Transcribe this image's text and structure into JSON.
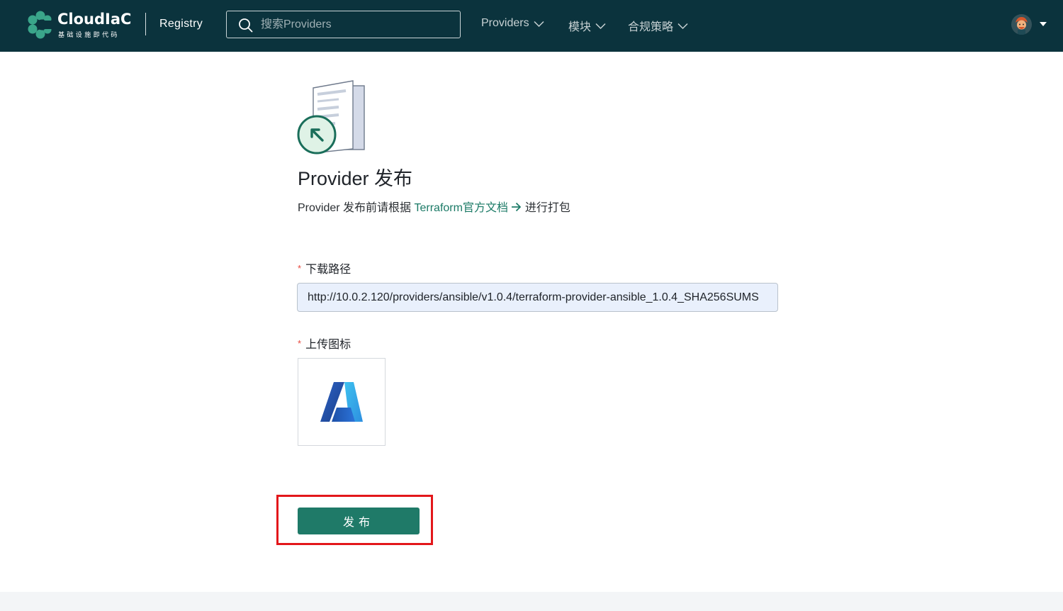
{
  "header": {
    "logo_title": "CloudIaC",
    "logo_subtitle": "基础设施即代码",
    "registry_label": "Registry",
    "search_placeholder": "搜索Providers",
    "nav": [
      {
        "label": "Providers"
      },
      {
        "label": "模块"
      },
      {
        "label": "合规策略"
      }
    ]
  },
  "main": {
    "title": "Provider 发布",
    "subtitle_prefix": "Provider 发布前请根据",
    "subtitle_link": "Terraform官方文档",
    "subtitle_suffix": "进行打包",
    "download_path_label": "下载路径",
    "download_path_value": "http://10.0.2.120/providers/ansible/v1.0.4/terraform-provider-ansible_1.0.4_SHA256SUMS",
    "upload_icon_label": "上传图标",
    "uploaded_icon": "azure-logo-icon",
    "publish_label": "发布"
  },
  "colors": {
    "header_bg": "#0b333d",
    "accent": "#1f7a68",
    "link": "#1b7a66",
    "highlight": "#e3171b"
  }
}
